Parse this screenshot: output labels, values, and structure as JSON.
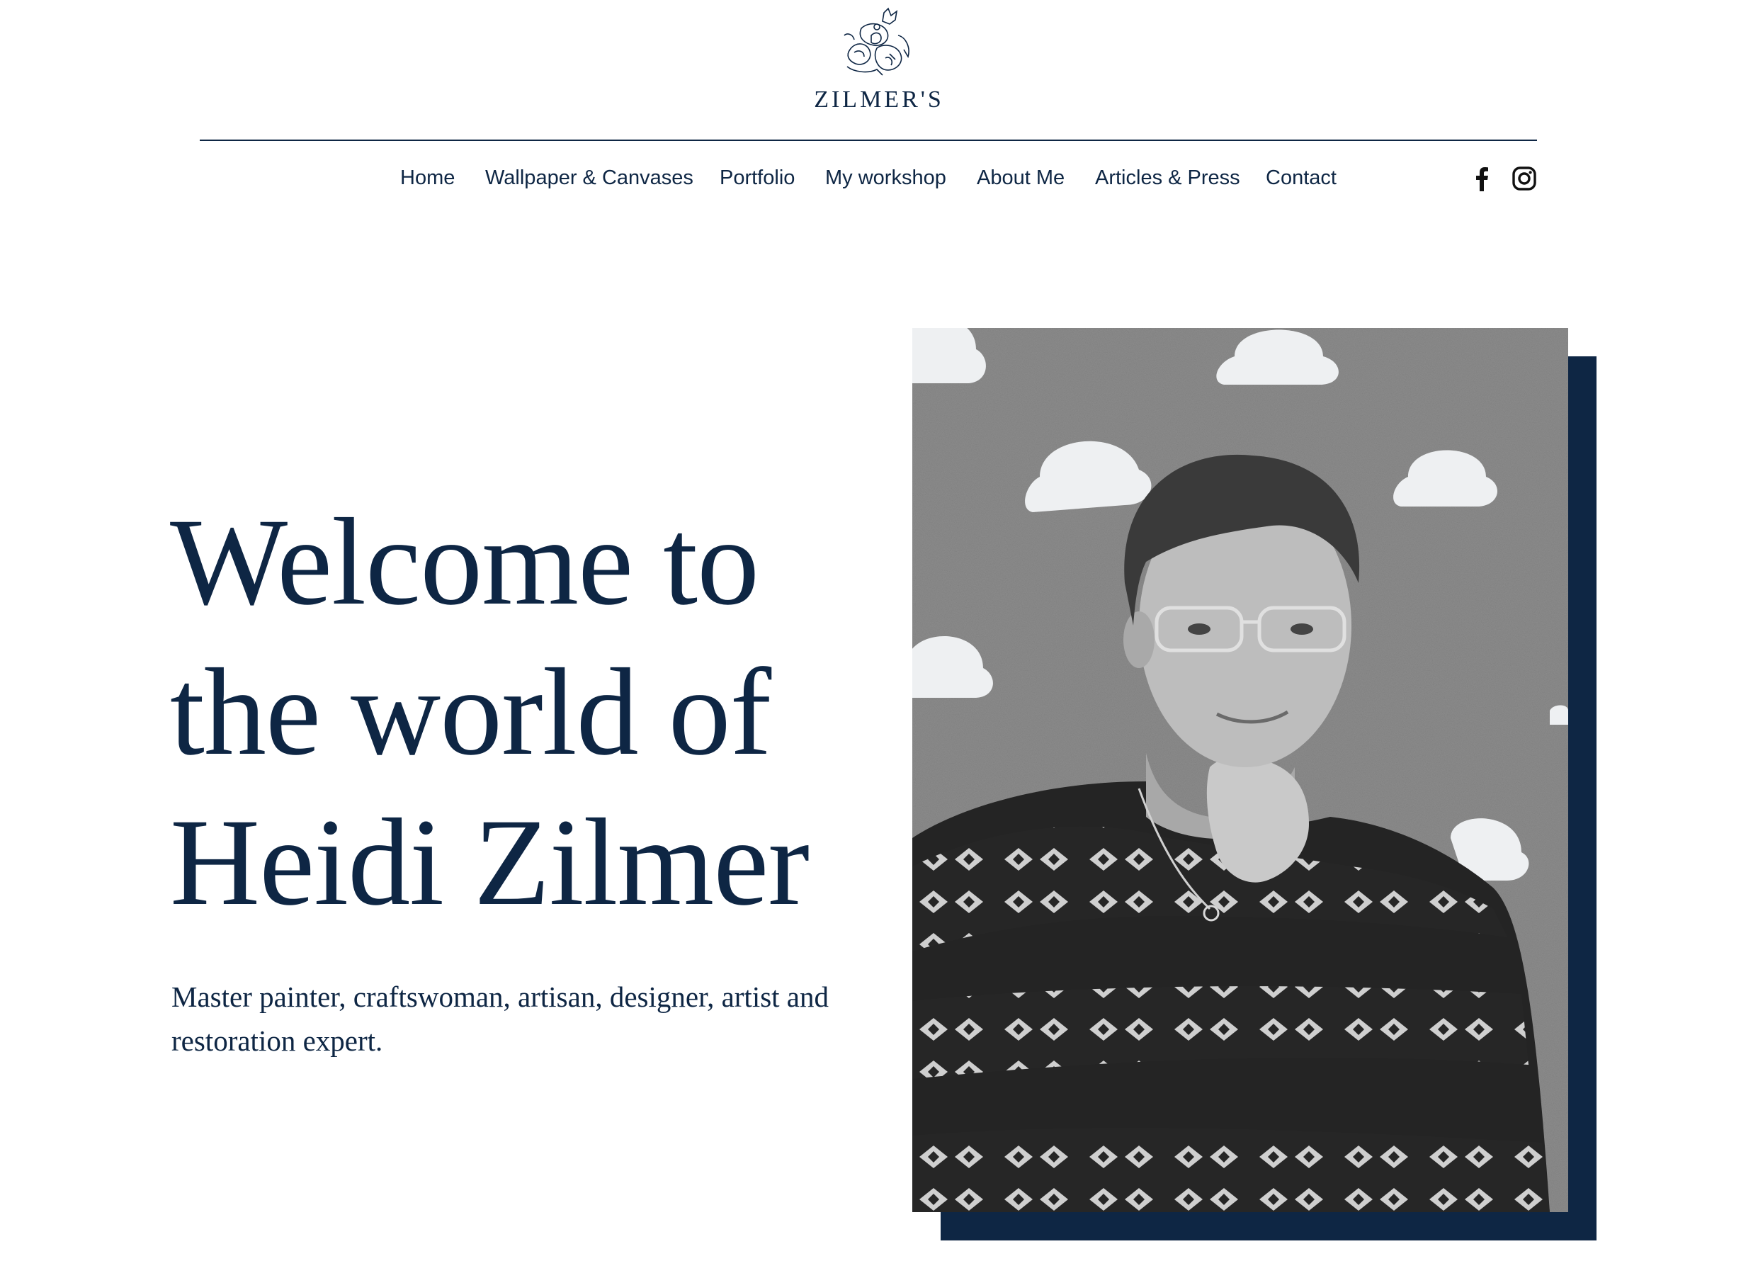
{
  "brand": {
    "name": "ZILMER'S"
  },
  "nav": {
    "items": [
      {
        "label": "Home"
      },
      {
        "label": "Wallpaper & Canvases"
      },
      {
        "label": "Portfolio"
      },
      {
        "label": "My workshop"
      },
      {
        "label": "About Me"
      },
      {
        "label": "Articles & Press"
      },
      {
        "label": "Contact"
      }
    ],
    "social": [
      {
        "icon": "facebook-icon"
      },
      {
        "icon": "instagram-icon"
      }
    ]
  },
  "hero": {
    "title_lines": [
      "Welcome to",
      "the world of",
      "Heidi Zilmer"
    ],
    "subtitle": "Master painter, craftswoman, artisan, designer, artist and restoration expert.",
    "photo_icon": "portrait-photo"
  },
  "colors": {
    "primary": "#0e2644",
    "background": "#ffffff"
  }
}
